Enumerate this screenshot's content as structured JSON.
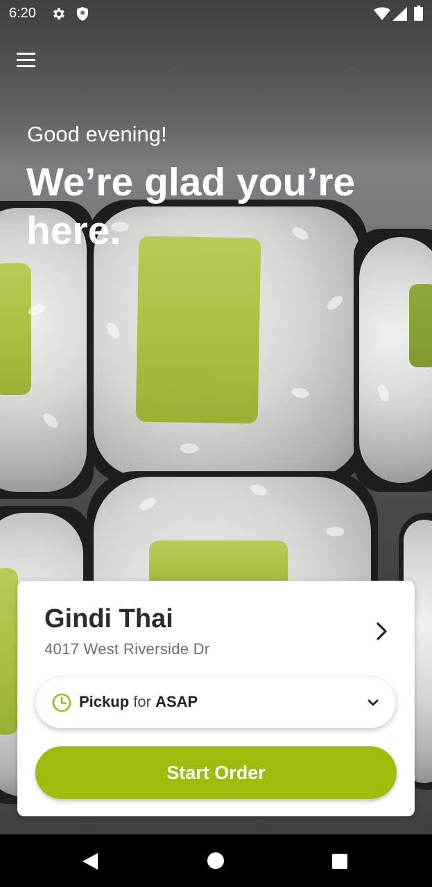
{
  "status_bar": {
    "time": "6:20",
    "icons": [
      "settings-gear-icon",
      "shield-icon",
      "wifi-icon",
      "cellular-signal-icon",
      "battery-icon"
    ]
  },
  "header": {
    "menu_icon": "hamburger-menu-icon",
    "greeting": "Good evening!",
    "headline": "We’re glad you’re here."
  },
  "store": {
    "name": "Gindi Thai",
    "address": "4017 West Riverside Dr"
  },
  "order_mode": {
    "mode": "Pickup",
    "connector": "for",
    "time": "ASAP",
    "icon": "clock-icon"
  },
  "cta": {
    "label": "Start Order"
  },
  "colors": {
    "accent": "#9fbb0b",
    "card_bg": "#ffffff",
    "text_dark": "#2b2b2b"
  },
  "nav_bar": {
    "icons": [
      "back-icon",
      "home-icon",
      "recent-apps-icon"
    ]
  }
}
